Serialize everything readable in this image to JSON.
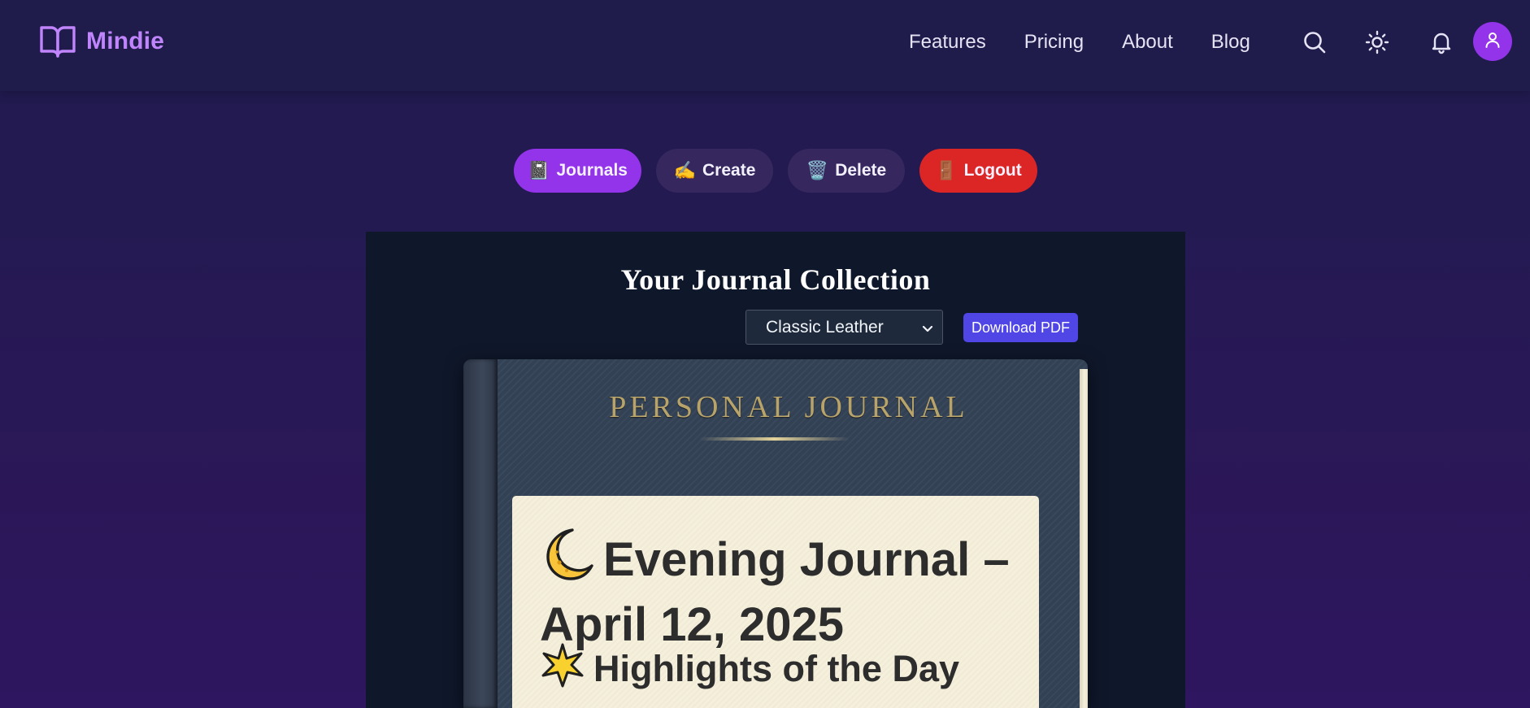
{
  "brand": {
    "name": "Mindie",
    "icon": "book-open-icon",
    "color": "#c084fc"
  },
  "nav": {
    "links": [
      "Features",
      "Pricing",
      "About",
      "Blog"
    ],
    "icons": [
      "search-icon",
      "sun-icon",
      "bell-icon",
      "user-icon"
    ]
  },
  "actions": {
    "journals": {
      "emoji": "📓",
      "label": "Journals",
      "color": "#9333ea"
    },
    "create": {
      "emoji": "✍️",
      "label": "Create",
      "color": "#36285f"
    },
    "delete": {
      "emoji": "🗑️",
      "label": "Delete",
      "color": "#36285f"
    },
    "logout": {
      "emoji": "🚪",
      "label": "Logout",
      "color": "#dc2626"
    }
  },
  "main": {
    "title": "Your Journal Collection",
    "theme_select": {
      "value": "Classic Leather"
    },
    "download_label": "Download PDF"
  },
  "book": {
    "cover_title": "PERSONAL JOURNAL",
    "entry_heading": "Evening Journal – April 12, 2025",
    "entry_heading_emoji": "moon-emoji",
    "entry_subheading": "Highlights of the Day",
    "entry_subheading_emoji": "star-emoji"
  }
}
